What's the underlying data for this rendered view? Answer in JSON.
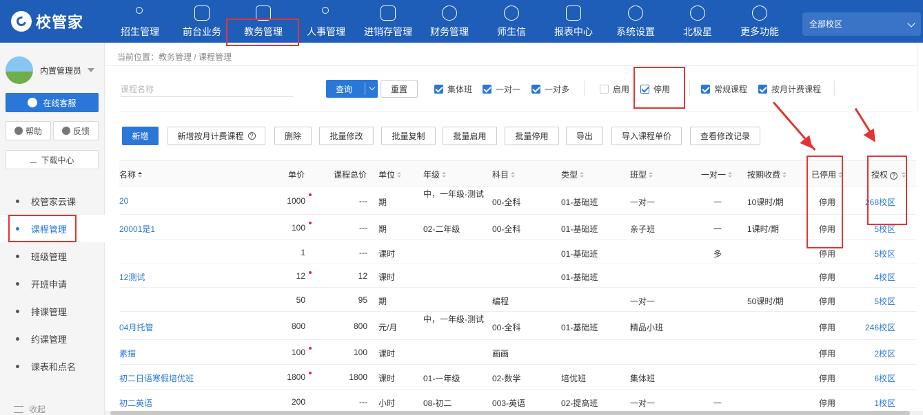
{
  "app": {
    "logo_text": "校管家"
  },
  "nav": {
    "items": [
      {
        "label": "招生管理",
        "icon": "person-add-icon"
      },
      {
        "label": "前台业务",
        "icon": "card-icon"
      },
      {
        "label": "教务管理",
        "icon": "book-icon"
      },
      {
        "label": "人事管理",
        "icon": "person-icon"
      },
      {
        "label": "进销存管理",
        "icon": "inventory-icon"
      },
      {
        "label": "财务管理",
        "icon": "finance-icon"
      },
      {
        "label": "师生信",
        "icon": "chat-icon"
      },
      {
        "label": "报表中心",
        "icon": "report-icon"
      },
      {
        "label": "系统设置",
        "icon": "settings-icon"
      },
      {
        "label": "北极星",
        "icon": "star-icon"
      },
      {
        "label": "更多功能",
        "icon": "more-icon"
      }
    ],
    "campus": "全部校区"
  },
  "sidebar": {
    "user": "内置管理员",
    "online_service": "在线客服",
    "help": "帮助",
    "feedback": "反馈",
    "download": "下载中心",
    "menu": [
      "校管家云课",
      "课程管理",
      "班级管理",
      "开班申请",
      "排课管理",
      "约课管理",
      "课表和点名"
    ],
    "collapse": "收起"
  },
  "breadcrumb": "当前位置：教务管理 / 课程管理",
  "filters": {
    "search_placeholder": "课程名称",
    "query": "查询",
    "reset": "重置",
    "checks": [
      {
        "label": "集体班",
        "checked": true
      },
      {
        "label": "一对一",
        "checked": true
      },
      {
        "label": "一对多",
        "checked": true
      },
      {
        "label": "启用",
        "checked": false
      },
      {
        "label": "停用",
        "checked": true
      },
      {
        "label": "常规课程",
        "checked": true
      },
      {
        "label": "按月计费课程",
        "checked": true
      }
    ]
  },
  "actions": [
    "新增",
    "新增按月计费课程",
    "删除",
    "批量修改",
    "批量复制",
    "批量启用",
    "批量停用",
    "导出",
    "导入课程单价",
    "查看修改记录"
  ],
  "table": {
    "headers": [
      "名称",
      "单价",
      "课程总价",
      "单位",
      "年级",
      "科目",
      "类型",
      "班型",
      "一对一",
      "按期收费",
      "已停用",
      "授权"
    ],
    "rows": [
      {
        "name": "20",
        "price": "1000",
        "total": "---",
        "unit": "期",
        "grade": "中，一年级-测试",
        "subject": "00-全科",
        "type": "01-基础班",
        "class": "一对一",
        "oto": "一",
        "period": "10课时/期",
        "status": "停用",
        "auth": "268校区",
        "dot": true
      },
      {
        "name": "20001是1",
        "price": "100",
        "total": "---",
        "unit": "期",
        "grade": "02-二年级",
        "subject": "00-全科",
        "type": "01-基础班",
        "class": "亲子班",
        "oto": "一",
        "period": "1课时/期",
        "status": "停用",
        "auth": "5校区",
        "dot": true
      },
      {
        "name": "",
        "price": "1",
        "total": "---",
        "unit": "课时",
        "grade": "",
        "subject": "",
        "type": "01-基础班",
        "class": "",
        "oto": "多",
        "period": "",
        "status": "停用",
        "auth": "5校区",
        "dot": false
      },
      {
        "name": "12测试",
        "price": "12",
        "total": "12",
        "unit": "课时",
        "grade": "",
        "subject": "",
        "type": "01-基础班",
        "class": "",
        "oto": "",
        "period": "",
        "status": "停用",
        "auth": "4校区",
        "dot": true
      },
      {
        "name": "",
        "price": "50",
        "total": "95",
        "unit": "期",
        "grade": "",
        "subject": "编程",
        "type": "",
        "class": "一对一",
        "oto": "",
        "period": "50课时/期",
        "status": "停用",
        "auth": "5校区",
        "dot": false
      },
      {
        "name": "04月托管",
        "price": "800",
        "total": "800",
        "unit": "元/月",
        "grade": "中，一年级-测试",
        "subject": "00-全科",
        "type": "01-基础班",
        "class": "精品小班",
        "oto": "",
        "period": "",
        "status": "停用",
        "auth": "246校区",
        "dot": false
      },
      {
        "name": " 素描",
        "price": "100",
        "total": "100",
        "unit": "课时",
        "grade": "",
        "subject": "画画",
        "type": "",
        "class": "",
        "oto": "",
        "period": "",
        "status": "停用",
        "auth": "2校区",
        "dot": true
      },
      {
        "name": "初二日语寒假培优班",
        "price": "1800",
        "total": "1800",
        "unit": "课时",
        "grade": "01-一年级",
        "subject": "02-数学",
        "type": "培优班",
        "class": "集体班",
        "oto": "",
        "period": "",
        "status": "停用",
        "auth": "6校区",
        "dot": true
      },
      {
        "name": "初二英语",
        "price": "200",
        "total": "---",
        "unit": "小时",
        "grade": "08-初二",
        "subject": "003-英语",
        "type": "02-提高班",
        "class": "一对一",
        "oto": "一",
        "period": "",
        "status": "停用",
        "auth": "1校区",
        "dot": false
      }
    ]
  },
  "colors": {
    "brand": "#1e5db8",
    "accent": "#2a77d8",
    "highlight": "#e53333"
  }
}
